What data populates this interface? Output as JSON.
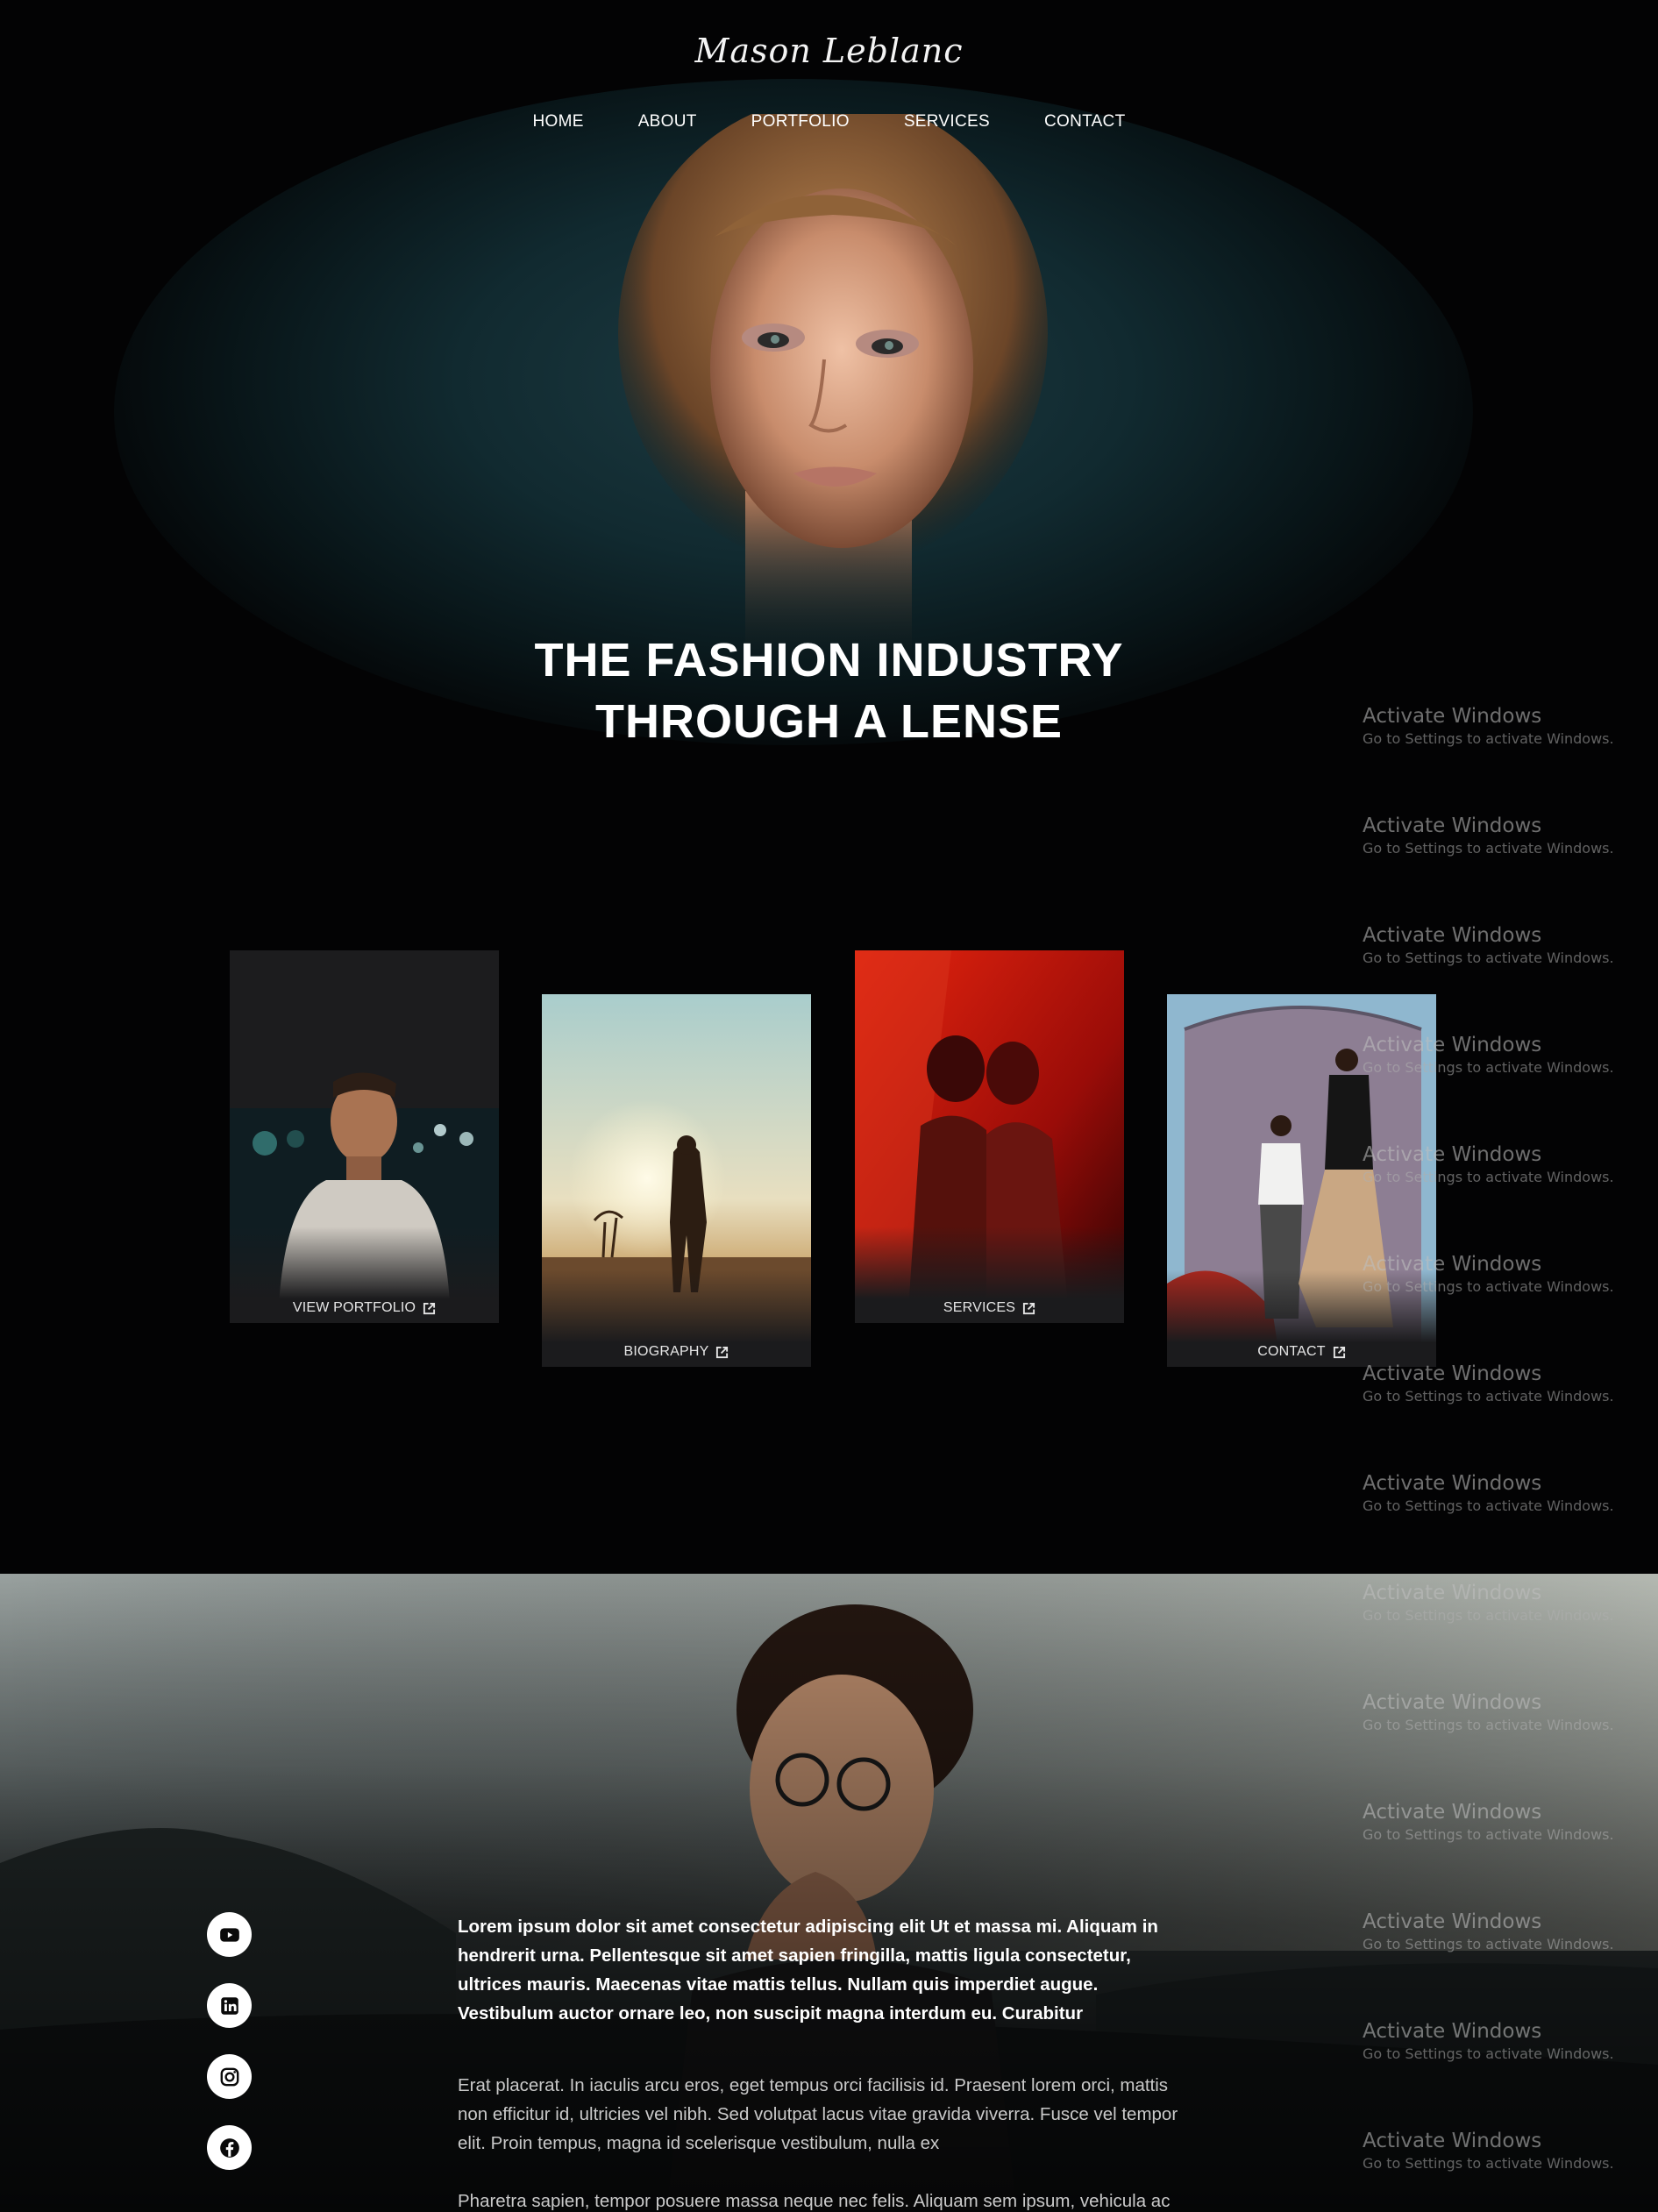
{
  "brand": {
    "logo_text": "Mason Leblanc"
  },
  "nav": {
    "items": [
      "HOME",
      "ABOUT",
      "PORTFOLIO",
      "SERVICES",
      "CONTACT"
    ]
  },
  "hero": {
    "title_line1": "THE FASHION INDUSTRY",
    "title_line2": "THROUGH A LENSE"
  },
  "cards": [
    {
      "label": "VIEW PORTFOLIO",
      "icon": "external-link-icon"
    },
    {
      "label": "BIOGRAPHY",
      "icon": "external-link-icon"
    },
    {
      "label": "SERVICES",
      "icon": "external-link-icon"
    },
    {
      "label": "CONTACT",
      "icon": "external-link-icon"
    }
  ],
  "social": [
    "youtube-icon",
    "linkedin-icon",
    "instagram-icon",
    "facebook-icon"
  ],
  "about": {
    "lead": "Lorem ipsum dolor sit amet consectetur adipiscing elit Ut et massa mi. Aliquam in hendrerit urna. Pellentesque sit amet sapien fringilla, mattis ligula consectetur, ultrices mauris. Maecenas vitae mattis tellus. Nullam quis imperdiet augue. Vestibulum auctor ornare leo, non suscipit magna interdum eu. Curabitur",
    "para1": "Erat placerat. In iaculis arcu eros, eget tempus orci facilisis id. Praesent lorem orci, mattis non efficitur id, ultricies vel nibh. Sed volutpat lacus vitae gravida viverra. Fusce vel tempor elit. Proin tempus, magna id scelerisque vestibulum, nulla ex",
    "para2": "Pharetra sapien, tempor posuere massa neque nec felis. Aliquam sem ipsum, vehicula ac"
  },
  "watermark": {
    "title": "Activate Windows",
    "subtitle": "Go to Settings to activate Windows."
  },
  "colors": {
    "background": "#020203",
    "accent_strip": "#b31212",
    "card_base": "#1b1b1d"
  }
}
